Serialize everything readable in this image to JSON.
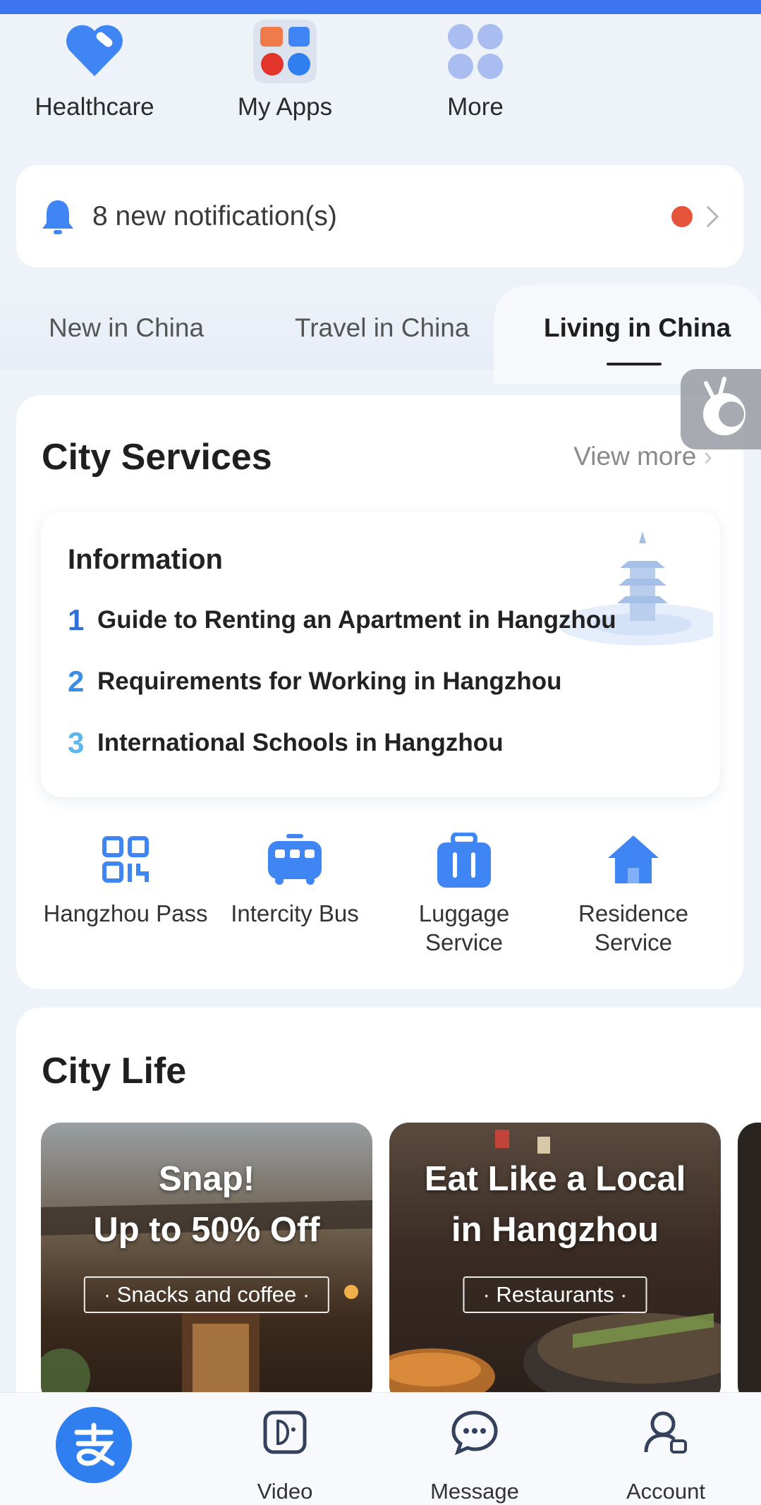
{
  "quick_apps": [
    {
      "label": "Healthcare",
      "icon": "healthcare-icon"
    },
    {
      "label": "My Apps",
      "icon": "my-apps-icon"
    },
    {
      "label": "More",
      "icon": "more-icon"
    }
  ],
  "notification": {
    "text": "8 new notification(s)"
  },
  "tabs": [
    {
      "label": "New in China"
    },
    {
      "label": "Travel in China"
    },
    {
      "label": "Living in China",
      "active": true
    }
  ],
  "city_services": {
    "title": "City Services",
    "view_more": "View more",
    "info": {
      "title": "Information",
      "items": [
        {
          "num": "1",
          "text": "Guide to Renting an Apartment in Hangzhou"
        },
        {
          "num": "2",
          "text": "Requirements for Working in Hangzhou"
        },
        {
          "num": "3",
          "text": "International Schools in Hangzhou"
        }
      ]
    },
    "services": [
      {
        "label": "Hangzhou Pass",
        "icon": "qr-code-icon"
      },
      {
        "label": "Intercity Bus",
        "icon": "bus-icon"
      },
      {
        "label": "Luggage Service",
        "icon": "luggage-icon"
      },
      {
        "label": "Residence Service",
        "icon": "house-icon"
      }
    ]
  },
  "city_life": {
    "title": "City Life",
    "promos": [
      {
        "line1": "Snap!",
        "line2": "Up to 50% Off",
        "tag": "Snacks and coffee"
      },
      {
        "line1": "Eat Like a Local",
        "line2": "in Hangzhou",
        "tag": "Restaurants"
      }
    ]
  },
  "bottom_nav": [
    {
      "label": "",
      "icon": "alipay-logo-icon"
    },
    {
      "label": "Video",
      "icon": "video-icon"
    },
    {
      "label": "Message",
      "icon": "message-icon"
    },
    {
      "label": "Account",
      "icon": "account-icon"
    }
  ],
  "colors": {
    "accent": "#3d74f0",
    "notif_dot": "#e5533a",
    "number_blue": "#3a8ee6"
  }
}
